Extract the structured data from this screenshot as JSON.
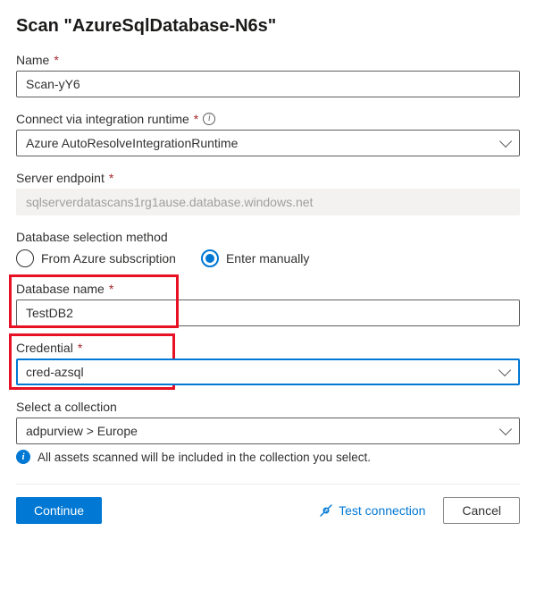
{
  "header": {
    "title": "Scan \"AzureSqlDatabase-N6s\""
  },
  "fields": {
    "name": {
      "label": "Name",
      "required": true,
      "value": "Scan-yY6"
    },
    "runtime": {
      "label": "Connect via integration runtime",
      "required": true,
      "value": "Azure AutoResolveIntegrationRuntime"
    },
    "endpoint": {
      "label": "Server endpoint",
      "required": true,
      "value": "sqlserverdatascans1rg1ause.database.windows.net"
    },
    "db_method": {
      "label": "Database selection method",
      "option_subscription": "From Azure subscription",
      "option_manual": "Enter manually",
      "selected": "manual"
    },
    "db_name": {
      "label": "Database name",
      "required": true,
      "value": "TestDB2"
    },
    "credential": {
      "label": "Credential",
      "required": true,
      "value": "cred-azsql"
    },
    "collection": {
      "label": "Select a collection",
      "value": "adpurview > Europe",
      "help": "All assets scanned will be included in the collection you select."
    }
  },
  "footer": {
    "continue": "Continue",
    "test": "Test connection",
    "cancel": "Cancel"
  }
}
